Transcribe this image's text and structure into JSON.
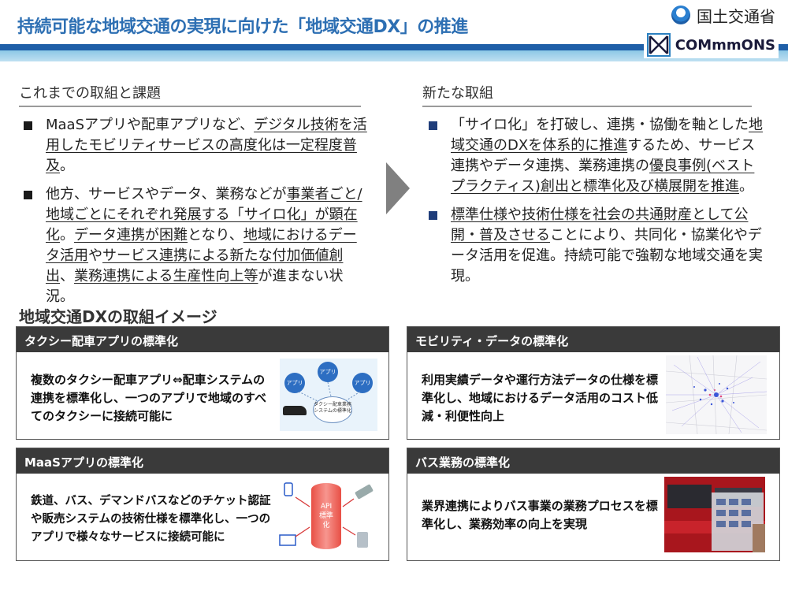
{
  "header": {
    "title": "持続可能な地域交通の実現に向けた「地域交通DX」の推進",
    "ministry": "国土交通省",
    "brand": "COMmmONS"
  },
  "left": {
    "heading": "これまでの取組と課題",
    "b1": [
      {
        "t": "MaaSアプリや配車アプリなど、",
        "u": false
      },
      {
        "t": "デジタル技術を活用したモビリティサービスの高度化は一定程度普及",
        "u": true
      },
      {
        "t": "。",
        "u": false
      }
    ],
    "b2": [
      {
        "t": "他方、サービスやデータ、業務などが",
        "u": false
      },
      {
        "t": "事業者ごと/地域ごとにそれぞれ発展する「サイロ化」が顕在化",
        "u": true
      },
      {
        "t": "。",
        "u": false
      },
      {
        "t": "データ連携が困難",
        "u": true
      },
      {
        "t": "となり、",
        "u": false
      },
      {
        "t": "地域におけるデータ活用",
        "u": true
      },
      {
        "t": "や",
        "u": false
      },
      {
        "t": "サービス連携による新たな付加価値創出",
        "u": true
      },
      {
        "t": "、",
        "u": false
      },
      {
        "t": "業務連携による生産性向上等",
        "u": true
      },
      {
        "t": "が進まない状況。",
        "u": false
      }
    ]
  },
  "right": {
    "heading": "新たな取組",
    "b1": [
      {
        "t": "「サイロ化」を打破し、連携・協働を軸とした",
        "u": false
      },
      {
        "t": "地域交通のDXを体系的に推進",
        "u": true
      },
      {
        "t": "するため、サービス連携やデータ連携、業務連携の",
        "u": false
      },
      {
        "t": "優良事例(ベストプラクティス)創出と標準化及び横展開を推進",
        "u": true
      },
      {
        "t": "。",
        "u": false
      }
    ],
    "b2": [
      {
        "t": "標準仕様や技術仕様を社会の共通財産として公開・普及させる",
        "u": true
      },
      {
        "t": "ことにより、共同化・協業化やデータ活用を促進。持続可能で強靭な地域交通を実現。",
        "u": false
      }
    ]
  },
  "section_title": "地域交通DXの取組イメージ",
  "cards": {
    "taxi": {
      "title": "タクシー配車アプリの標準化",
      "body": "複数のタクシー配車アプリ⇔配車システムの連携を標準化し、一つのアプリで地域のすべてのタクシーに接続可能に",
      "bubble": "アプリ",
      "hub": "タクシー配車業務システムの標準化"
    },
    "mobility": {
      "title": "モビリティ・データの標準化",
      "body": "利用実績データや運行方法データの仕様を標準化し、地域におけるデータ活用のコスト低減・利便性向上"
    },
    "maas": {
      "title": "MaaSアプリの標準化",
      "body": "鉄道、バス、デマンドバスなどのチケット認証や販売システムの技術仕様を標準化し、一つのアプリで様々なサービスに接続可能に",
      "api": "API\n標準\n化"
    },
    "bus": {
      "title": "バス業務の標準化",
      "body": "業界連携によりバス事業の業務プロセスを標準化し、業務効率の向上を実現"
    }
  }
}
